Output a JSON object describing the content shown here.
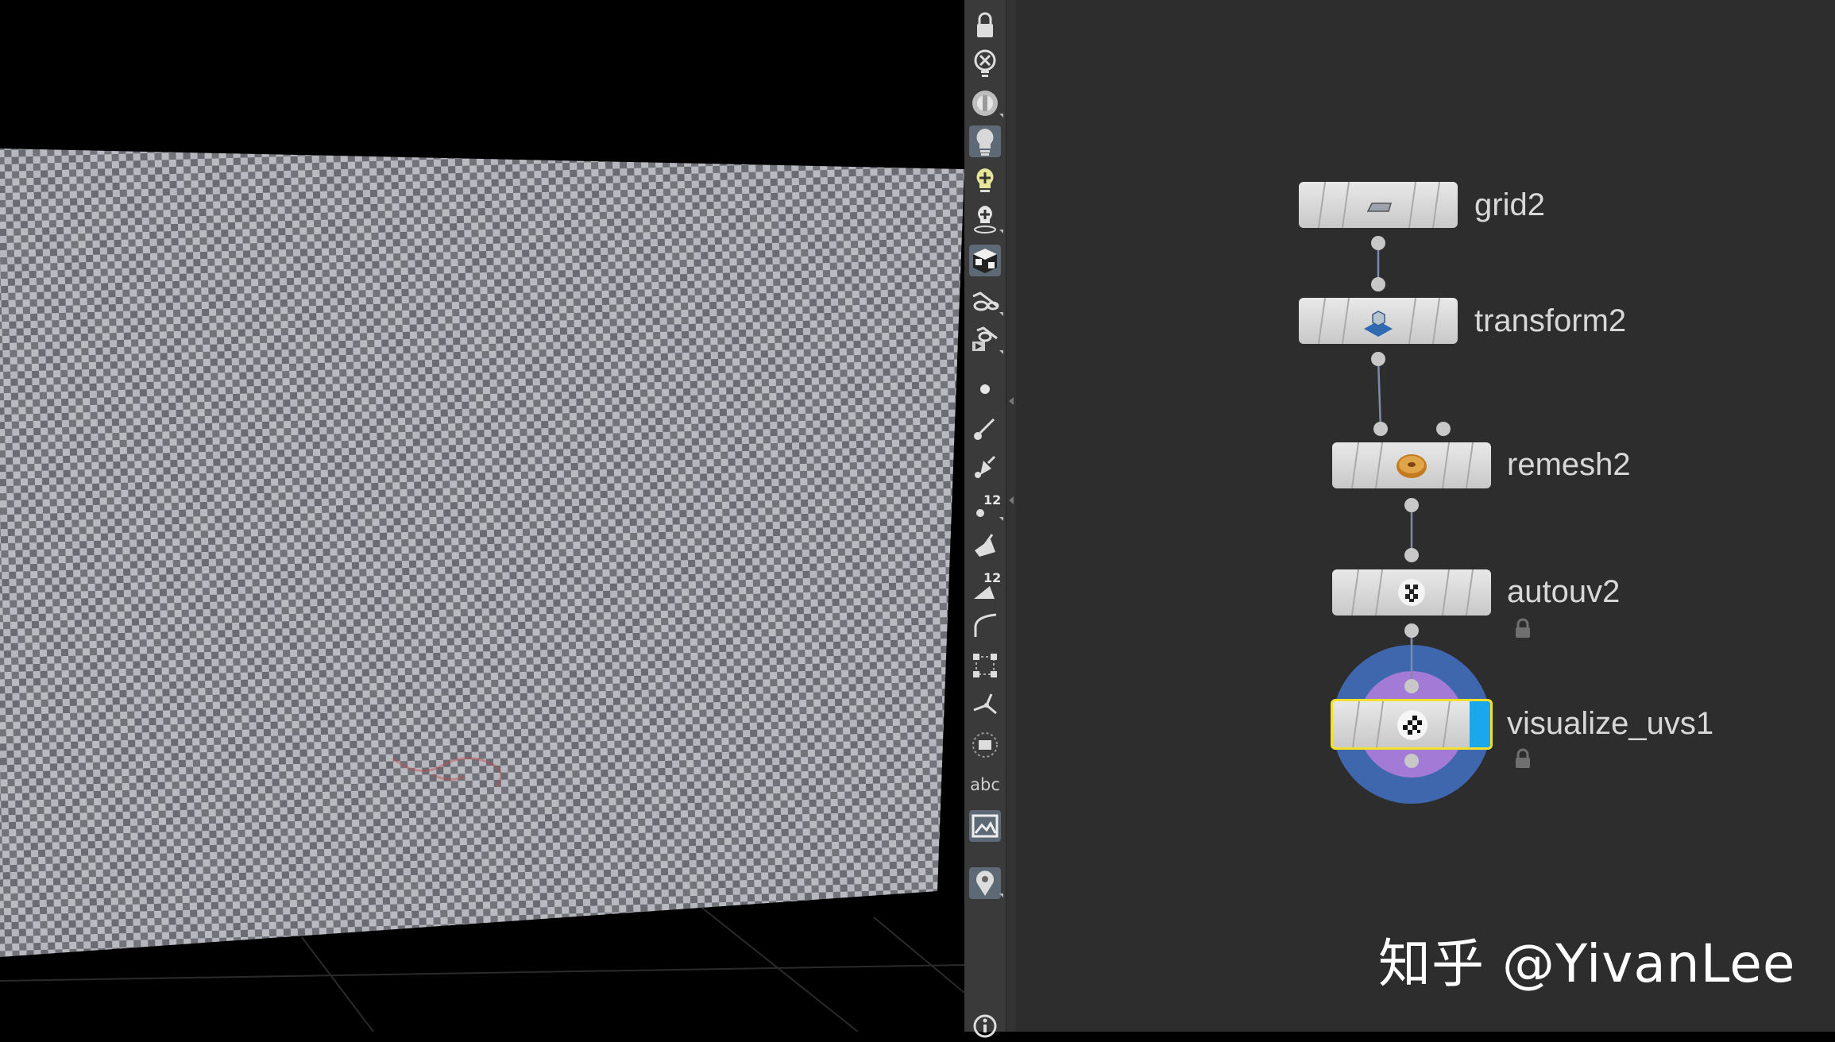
{
  "viewport": {
    "background_color": "#000000",
    "checker_light": "#b4b4bc",
    "checker_dark": "#6a6a72"
  },
  "toolbar": {
    "tools": [
      {
        "name": "lock-icon"
      },
      {
        "name": "close-icon"
      },
      {
        "name": "sphere-shading-icon"
      },
      {
        "name": "lightbulb-icon"
      },
      {
        "name": "add-light-icon"
      },
      {
        "name": "light-pin-icon"
      },
      {
        "name": "cube-display-icon"
      },
      {
        "name": "glasses-icon"
      },
      {
        "name": "camera-glasses-icon"
      },
      {
        "name": "point-icon"
      },
      {
        "name": "brush-icon"
      },
      {
        "name": "pin-icon"
      },
      {
        "name": "point-numbers-icon"
      },
      {
        "name": "paint-icon"
      },
      {
        "name": "prim-numbers-icon"
      },
      {
        "name": "curve-icon"
      },
      {
        "name": "bounding-box-icon"
      },
      {
        "name": "normals-icon"
      },
      {
        "name": "dashed-frame-icon"
      },
      {
        "name": "abc-icon"
      },
      {
        "name": "background-image-icon"
      },
      {
        "name": "location-pin-icon"
      },
      {
        "name": "info-icon"
      }
    ],
    "point_number_label": "12",
    "prim_number_label": "12",
    "abc_label": "abc"
  },
  "network": {
    "background_color": "#2d2d2d",
    "nodes": [
      {
        "label": "grid2",
        "icon": "grid-plane-icon"
      },
      {
        "label": "transform2",
        "icon": "transform-icon"
      },
      {
        "label": "remesh2",
        "icon": "donut-icon"
      },
      {
        "label": "autouv2",
        "icon": "checker-blob-icon"
      },
      {
        "label": "visualize_uvs1",
        "icon": "checker-sphere-icon"
      }
    ],
    "selected_node": "visualize_uvs1",
    "display_flag_color": "#1aa7ec",
    "selection_color": "#f3e02a"
  },
  "watermark": "知乎 @YivanLee"
}
